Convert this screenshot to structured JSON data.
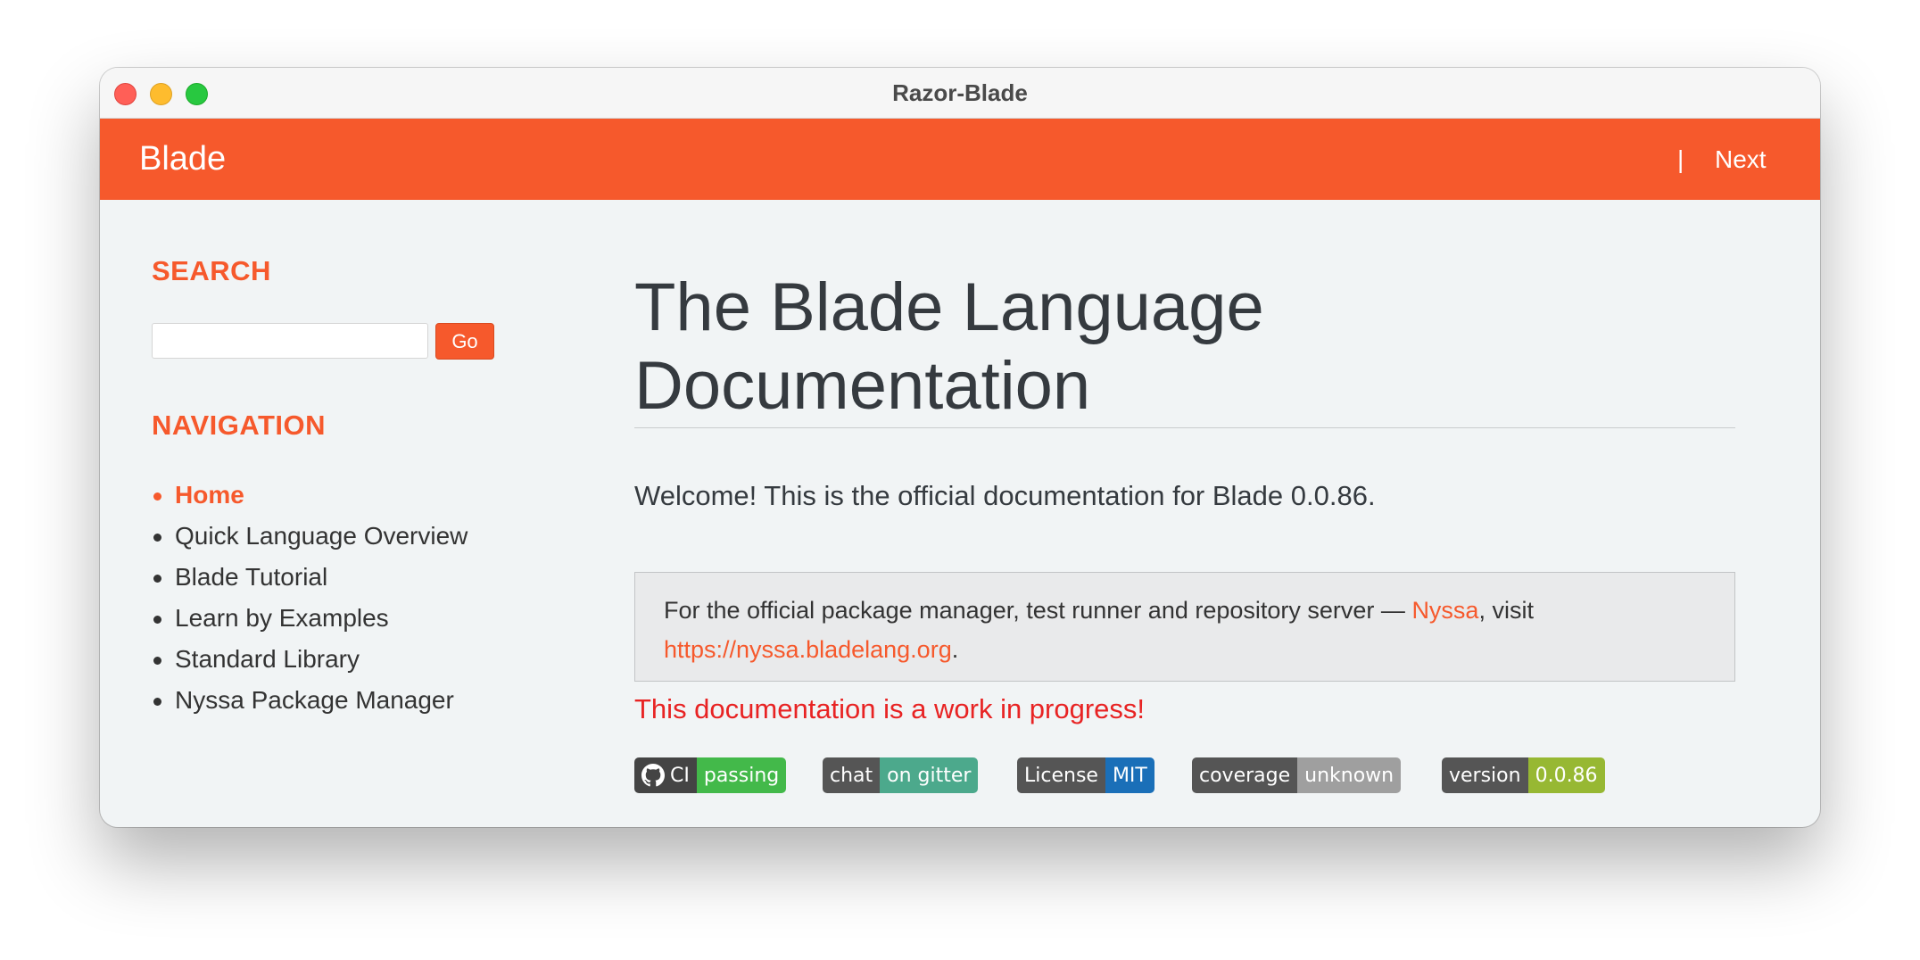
{
  "window": {
    "title": "Razor-Blade"
  },
  "navbar": {
    "brand": "Blade",
    "separator": "|",
    "next_label": "Next"
  },
  "sidebar": {
    "search_heading": "SEARCH",
    "search_value": "",
    "go_label": "Go",
    "navigation_heading": "NAVIGATION",
    "items": [
      {
        "label": "Home",
        "active": true
      },
      {
        "label": "Quick Language Overview",
        "active": false
      },
      {
        "label": "Blade Tutorial",
        "active": false
      },
      {
        "label": "Learn by Examples",
        "active": false
      },
      {
        "label": "Standard Library",
        "active": false
      },
      {
        "label": "Nyssa Package Manager",
        "active": false
      }
    ]
  },
  "main": {
    "title_line1": "The Blade Language",
    "title_line2": "Documentation",
    "welcome": "Welcome! This is the official documentation for Blade 0.0.86.",
    "notice": {
      "text_before": "For the official package manager, test runner and repository server — ",
      "link_nyssa": "Nyssa",
      "text_middle": ", visit",
      "link_url": "https://nyssa.bladelang.org",
      "text_after": "."
    },
    "wip": "This documentation is a work in progress!",
    "badges": [
      {
        "label": "CI",
        "value": "passing",
        "color": "#4c1",
        "icon": "github-icon"
      },
      {
        "label": "chat",
        "value": "on gitter",
        "color": "#4ca98c"
      },
      {
        "label": "License",
        "value": "MIT",
        "color": "#1a6fb8"
      },
      {
        "label": "coverage",
        "value": "unknown",
        "color": "#9f9f9f"
      },
      {
        "label": "version",
        "value": "0.0.86",
        "color": "#97b833"
      }
    ]
  },
  "colors": {
    "accent": "#f6592c",
    "background": "#f1f4f5",
    "wip": "#e82323"
  }
}
